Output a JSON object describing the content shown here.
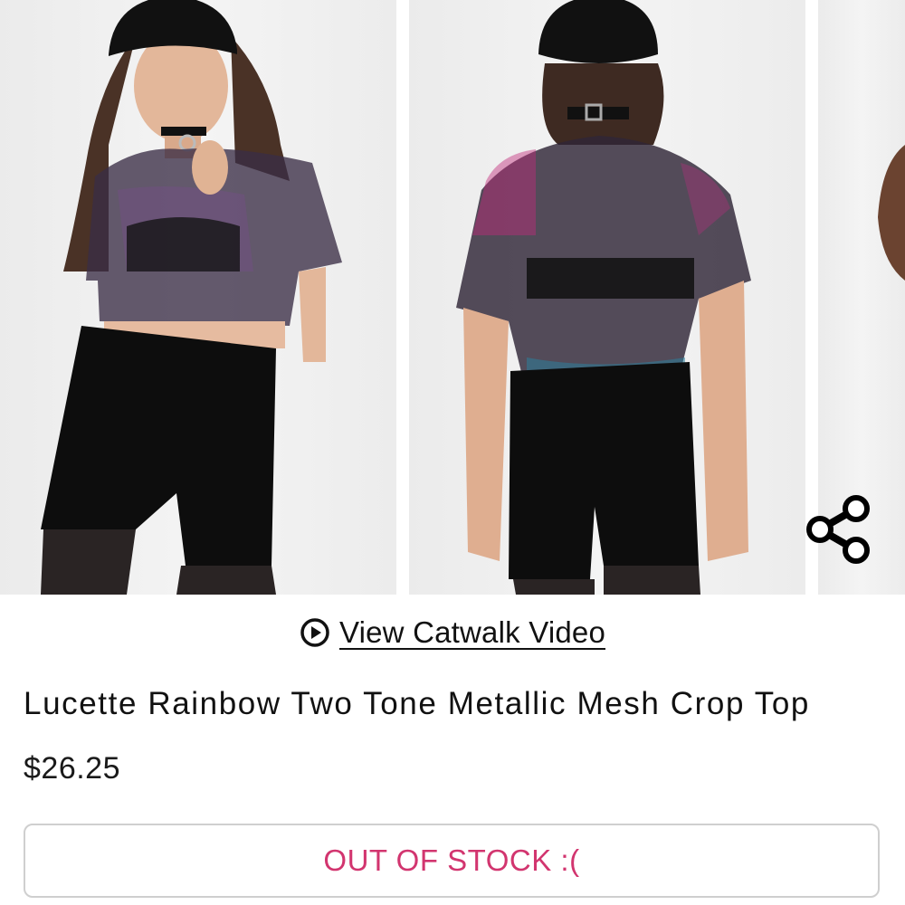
{
  "gallery": {
    "photos": [
      {
        "icon": "model-front-photo"
      },
      {
        "icon": "model-back-photo"
      },
      {
        "icon": "model-side-photo"
      }
    ],
    "share_icon": "share-icon"
  },
  "catwalk": {
    "icon": "play-circle-icon",
    "label": "View Catwalk Video"
  },
  "product": {
    "title": "Lucette Rainbow Two Tone Metallic Mesh Crop Top",
    "price": "$26.25",
    "stock_button_label": "OUT OF STOCK :(",
    "stock_button_color": "#d2356f"
  }
}
